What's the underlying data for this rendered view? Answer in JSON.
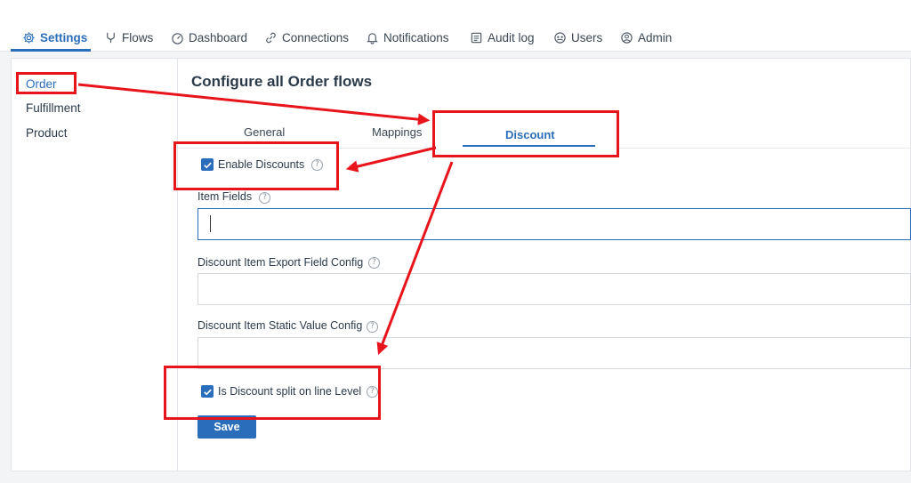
{
  "topnav": {
    "items": [
      {
        "label": "Settings",
        "icon": "gear-icon",
        "active": true
      },
      {
        "label": "Flows",
        "icon": "flows-icon"
      },
      {
        "label": "Dashboard",
        "icon": "dashboard-icon"
      },
      {
        "label": "Connections",
        "icon": "link-icon"
      },
      {
        "label": "Notifications",
        "icon": "bell-icon"
      },
      {
        "label": "Audit log",
        "icon": "audit-log-icon"
      },
      {
        "label": "Users",
        "icon": "users-icon"
      },
      {
        "label": "Admin",
        "icon": "admin-user-icon"
      }
    ]
  },
  "sidebar": {
    "items": [
      {
        "label": "Order",
        "active": true
      },
      {
        "label": "Fulfillment"
      },
      {
        "label": "Product"
      }
    ]
  },
  "main": {
    "title": "Configure all Order flows",
    "tabs": [
      {
        "label": "General"
      },
      {
        "label": "Mappings"
      },
      {
        "label": "Discount",
        "active": true
      }
    ],
    "enable_discounts": {
      "label": "Enable Discounts",
      "checked": true
    },
    "item_fields": {
      "label": "Item Fields",
      "value": ""
    },
    "export_field_config": {
      "label": "Discount Item Export Field Config",
      "value": ""
    },
    "static_value_config": {
      "label": "Discount Item Static Value Config",
      "value": ""
    },
    "split_line_level": {
      "label": "Is Discount split on line Level",
      "checked": true
    },
    "save_label": "Save",
    "help_glyph": "?"
  },
  "colors": {
    "accent": "#2a6ebb",
    "annotation": "#e8141c"
  }
}
